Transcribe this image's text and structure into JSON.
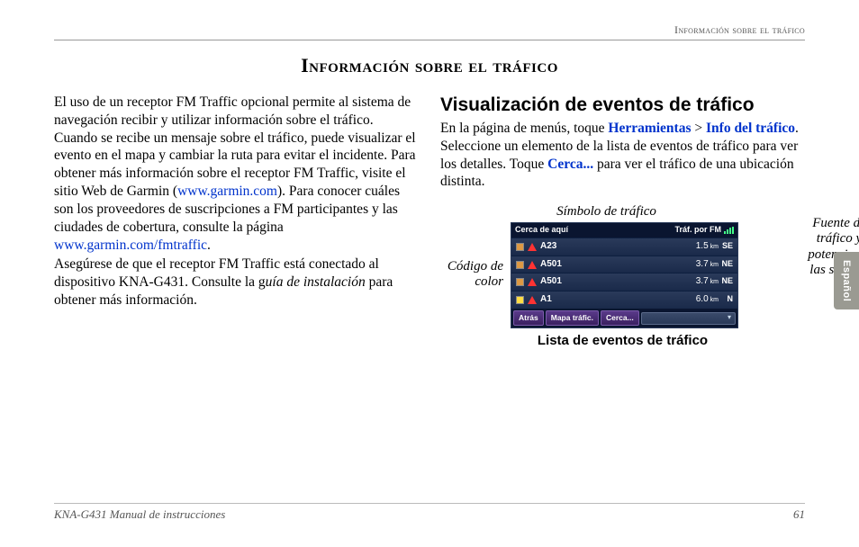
{
  "running_header": "Información sobre el tráfico",
  "page_title": "Información sobre el tráfico",
  "left_column": {
    "p1_a": "El uso de un receptor FM Traffic opcional permite al sistema de navegación recibir y utilizar información sobre el tráfico. Cuando se recibe un mensaje sobre el tráfico, puede visualizar el evento en el mapa y cambiar la ruta para evitar el incidente. Para obtener más información sobre el receptor FM Traffic, visite el sitio Web de Garmin (",
    "link1": "www.garmin.com",
    "p1_b": "). Para conocer cuáles son los proveedores de suscripciones a FM participantes y las ciudades de cobertura, consulte la página ",
    "link2": "www.garmin.com/fmtraffic",
    "p1_c": ".",
    "p2_a": "Asegúrese de que el receptor FM Traffic está conectado al dispositivo KNA-G431. Consulte la g",
    "p2_italic": "uía de instalación",
    "p2_b": " para obtener más información."
  },
  "right_column": {
    "heading": "Visualización de eventos de tráfico",
    "p1_a": "En la página de menús, toque ",
    "b1": "Herramientas",
    "gt": " > ",
    "b2": "Info del tráfico",
    "p1_b": ". Seleccione un elemento de la lista de eventos de tráfico para ver los detalles. Toque ",
    "b3": "Cerca...",
    "p1_c": " para ver el tráfico de una ubicación distinta."
  },
  "callouts": {
    "top": "Símbolo de tráfico",
    "left": "Código de color",
    "right": "Fuente de tráfico y potencia de las señales",
    "bottom": "Lista de eventos de tráfico"
  },
  "device": {
    "title_left": "Cerca de aquí",
    "title_right": "Tráf. por FM",
    "rows": [
      {
        "color": "#d94",
        "road": "A23",
        "dist": "1.5",
        "unit": "km",
        "dir": "SE"
      },
      {
        "color": "#d94",
        "road": "A501",
        "dist": "3.7",
        "unit": "km",
        "dir": "NE"
      },
      {
        "color": "#d94",
        "road": "A501",
        "dist": "3.7",
        "unit": "km",
        "dir": "NE"
      },
      {
        "color": "#fd4",
        "road": "A1",
        "dist": "6.0",
        "unit": "km",
        "dir": "N"
      }
    ],
    "buttons": {
      "back": "Atrás",
      "map": "Mapa tráfic.",
      "near": "Cerca..."
    }
  },
  "side_tab": "Español",
  "footer": {
    "left": "KNA-G431 Manual de instrucciones",
    "right": "61"
  }
}
